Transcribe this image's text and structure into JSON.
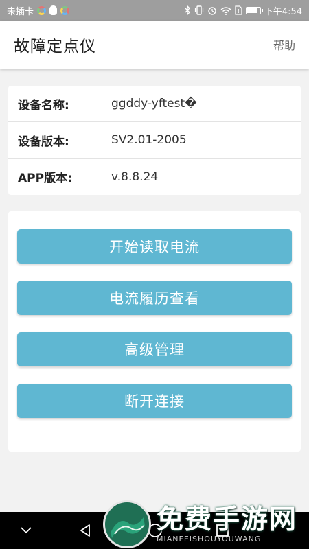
{
  "status_bar": {
    "carrier": "未插卡",
    "time": "下午4:54",
    "battery_level_percent": 80,
    "icons": [
      "bluetooth-icon",
      "vibrate-icon",
      "alarm-icon",
      "wifi-icon",
      "sim-icon",
      "battery-icon"
    ]
  },
  "app_bar": {
    "title": "故障定点仪",
    "help": "帮助"
  },
  "device_info": {
    "rows": [
      {
        "label": "设备名称:",
        "value": "ggddy-yftest�"
      },
      {
        "label": "设备版本:",
        "value": "SV2.01-2005"
      },
      {
        "label": "APP版本:",
        "value": "v.8.8.24"
      }
    ]
  },
  "actions": {
    "read_current": "开始读取电流",
    "current_history": "电流履历查看",
    "advanced_management": "高级管理",
    "disconnect": "断开连接"
  },
  "watermark": {
    "text_cn": "免费手游网",
    "text_en": "MIANFEISHOUYOUWANG"
  },
  "colors": {
    "status_bar": "#9e9e9e",
    "button": "#5fb7d2",
    "background": "#f2f2f2",
    "nav_bar": "#000000",
    "watermark_green": "#1f6f54"
  }
}
